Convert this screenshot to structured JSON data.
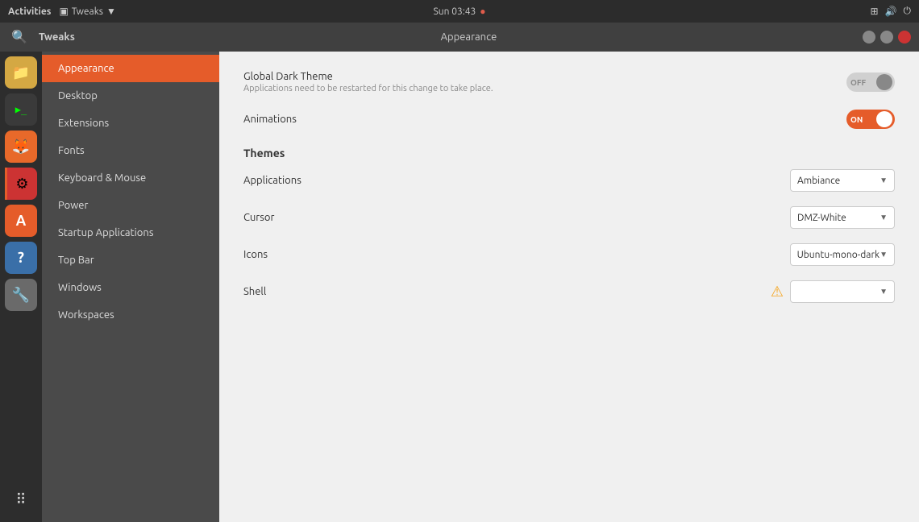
{
  "system_bar": {
    "activities": "Activities",
    "tweaks_menu": "Tweaks",
    "time": "Sun 03:43",
    "dot": "●"
  },
  "window": {
    "search_icon": "🔍",
    "tweaks_label": "Tweaks",
    "title": "Appearance"
  },
  "sidebar": {
    "items": [
      {
        "id": "appearance",
        "label": "Appearance",
        "active": true
      },
      {
        "id": "desktop",
        "label": "Desktop"
      },
      {
        "id": "extensions",
        "label": "Extensions"
      },
      {
        "id": "fonts",
        "label": "Fonts"
      },
      {
        "id": "keyboard-mouse",
        "label": "Keyboard & Mouse"
      },
      {
        "id": "power",
        "label": "Power"
      },
      {
        "id": "startup-applications",
        "label": "Startup Applications"
      },
      {
        "id": "top-bar",
        "label": "Top Bar"
      },
      {
        "id": "windows",
        "label": "Windows"
      },
      {
        "id": "workspaces",
        "label": "Workspaces"
      }
    ]
  },
  "content": {
    "global_dark_theme_label": "Global Dark Theme",
    "global_dark_theme_sublabel": "Applications need to be restarted for this change to take place.",
    "global_dark_theme_state": "OFF",
    "animations_label": "Animations",
    "animations_state": "ON",
    "themes_heading": "Themes",
    "applications_label": "Applications",
    "applications_value": "Ambiance",
    "cursor_label": "Cursor",
    "cursor_value": "DMZ-White",
    "icons_label": "Icons",
    "icons_value": "Ubuntu-mono-dark",
    "shell_label": "Shell",
    "shell_value": "",
    "shell_warning": "⚠"
  },
  "taskbar": {
    "files_icon": "📁",
    "terminal_icon": ">_",
    "firefox_icon": "🦊",
    "settings_icon": "⚙",
    "software_icon": "A",
    "help_icon": "?",
    "tools_icon": "🔧",
    "apps_grid_icon": "⠿"
  },
  "colors": {
    "active_nav": "#e55c2a",
    "toggle_on": "#e55c2a",
    "toggle_off": "#ccc",
    "warning": "#f5a623"
  }
}
